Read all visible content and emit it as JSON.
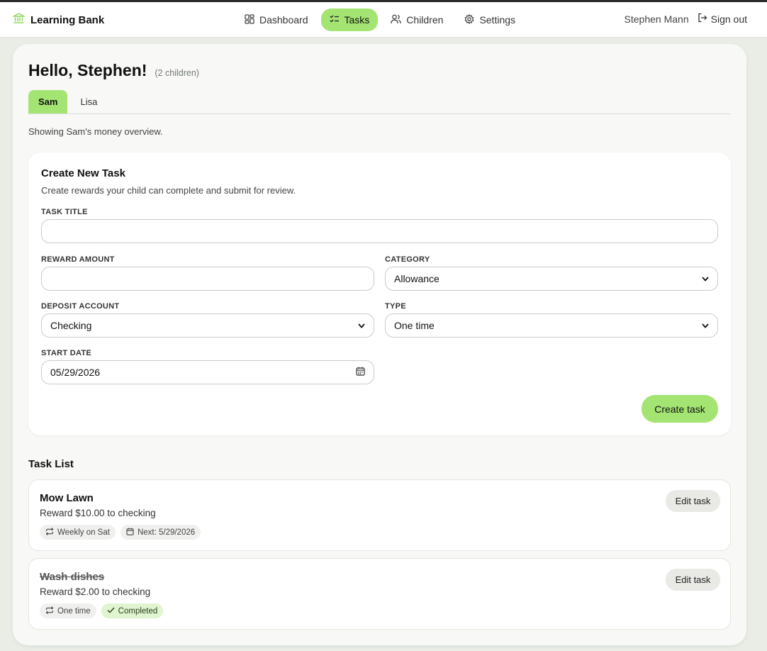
{
  "app": {
    "name": "Learning Bank",
    "logo_icon": "bank-icon",
    "accent_color": "#a3e472"
  },
  "nav": {
    "items": [
      {
        "label": "Dashboard",
        "icon": "dashboard-grid-icon",
        "active": false
      },
      {
        "label": "Tasks",
        "icon": "checklist-icon",
        "active": true
      },
      {
        "label": "Children",
        "icon": "users-icon",
        "active": false
      },
      {
        "label": "Settings",
        "icon": "gear-icon",
        "active": false
      }
    ]
  },
  "user": {
    "name": "Stephen Mann",
    "signout_label": "Sign out",
    "signout_icon": "sign-out-icon"
  },
  "page": {
    "greeting": "Hello, Stephen!",
    "children_count": "(2 children)",
    "child_tabs": [
      {
        "label": "Sam",
        "active": true
      },
      {
        "label": "Lisa",
        "active": false
      }
    ],
    "overview_text": "Showing Sam's money overview."
  },
  "form": {
    "title": "Create New Task",
    "subtitle": "Create rewards your child can complete and submit for review.",
    "task_title": {
      "label": "TASK TITLE",
      "value": ""
    },
    "reward_amount": {
      "label": "REWARD AMOUNT",
      "value": ""
    },
    "category": {
      "label": "CATEGORY",
      "value": "Allowance"
    },
    "deposit_account": {
      "label": "DEPOSIT ACCOUNT",
      "value": "Checking"
    },
    "type": {
      "label": "TYPE",
      "value": "One time"
    },
    "start_date": {
      "label": "START DATE",
      "value": "05/29/2026",
      "icon": "calendar-icon"
    },
    "submit_label": "Create task"
  },
  "task_list": {
    "title": "Task List",
    "tasks": [
      {
        "title": "Mow Lawn",
        "completed": false,
        "reward": "Reward $10.00 to checking",
        "chips": [
          {
            "icon": "repeat-icon",
            "label": "Weekly on Sat"
          },
          {
            "icon": "calendar-icon",
            "label": "Next: 5/29/2026"
          }
        ],
        "edit_label": "Edit task"
      },
      {
        "title": "Wash dishes",
        "completed": true,
        "reward": "Reward $2.00 to checking",
        "chips": [
          {
            "icon": "repeat-icon",
            "label": "One time"
          },
          {
            "icon": "check-icon",
            "label": "Completed"
          }
        ],
        "edit_label": "Edit task"
      }
    ]
  }
}
